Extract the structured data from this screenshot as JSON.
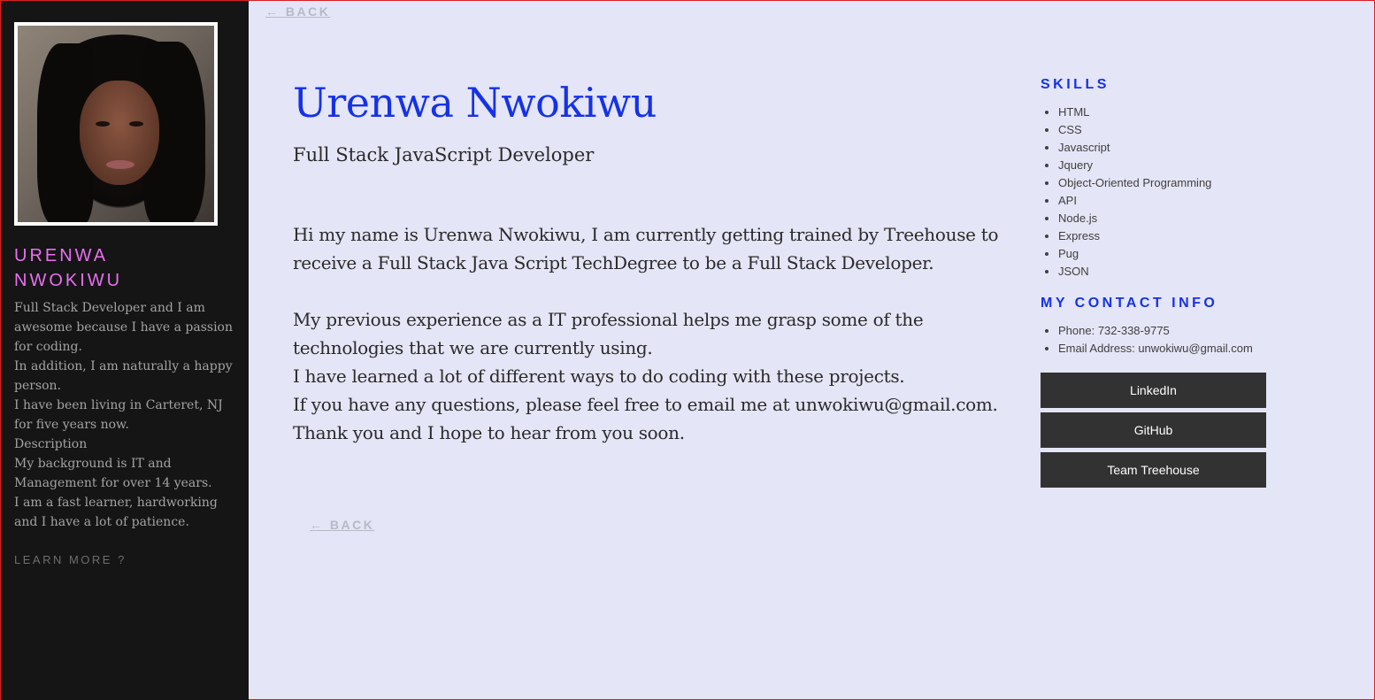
{
  "sidebar": {
    "name_line1": "URENWA",
    "name_line2": "NWOKIWU",
    "bio": [
      "Full Stack Developer and I am awesome because I have a passion for coding.",
      "In addition, I am naturally a happy person.",
      "I have been living in Carteret, NJ for five years now.",
      "Description",
      "My background is IT and Management for over 14 years.",
      "I am a fast learner, hardworking and I have a lot of patience."
    ],
    "learn_more": "LEARN MORE ?"
  },
  "main": {
    "back_top": "← BACK",
    "name": "Urenwa Nwokiwu",
    "title": "Full Stack JavaScript Developer",
    "about": [
      "Hi my name is Urenwa Nwokiwu, I am currently getting trained by Treehouse to receive a Full Stack Java Script TechDegree to be a Full Stack Developer.",
      "",
      "My previous experience as a IT professional helps me grasp some of the technologies that we are currently using.",
      "I have learned a lot of different ways to do coding with these projects.",
      "If you have any questions, please feel free to email me at unwokiwu@gmail.com.",
      "Thank you and I hope to hear from you soon."
    ],
    "back_bottom": "← BACK"
  },
  "skills": {
    "heading": "SKILLS",
    "items": [
      "HTML",
      "CSS",
      "Javascript",
      "Jquery",
      "Object-Oriented Programming",
      "API",
      "Node.js",
      "Express",
      "Pug",
      "JSON"
    ]
  },
  "contact": {
    "heading": "MY CONTACT INFO",
    "phone": "Phone: 732-338-9775",
    "email": "Email Address: unwokiwu@gmail.com"
  },
  "buttons": {
    "linkedin": "LinkedIn",
    "github": "GitHub",
    "treehouse": "Team Treehouse"
  },
  "colors": {
    "sidebar_bg": "#151516",
    "main_bg": "#e4e5f6",
    "accent_blue": "#1532e6",
    "accent_pink": "#ea6ff0",
    "button_bg": "#323232"
  }
}
